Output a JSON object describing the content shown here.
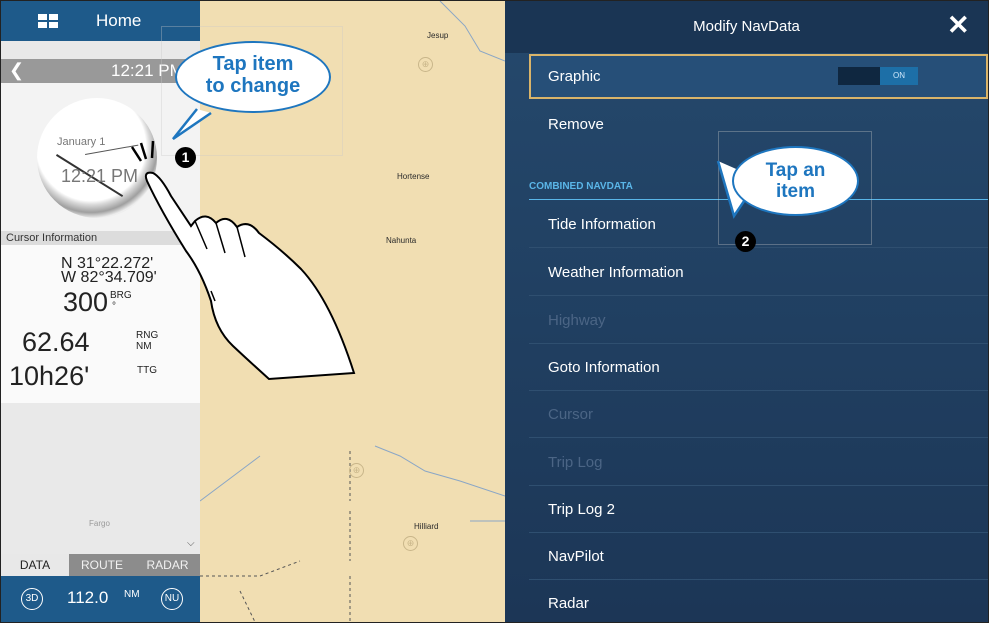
{
  "map": {
    "towns": [
      "Jesup",
      "Hortense",
      "Nahunta",
      "Hilliard",
      "Fargo"
    ]
  },
  "left_panel": {
    "title": "Home",
    "time": "12:21 PM",
    "clock_date": "January 1",
    "clock_time": "12:21 PM",
    "cursor_header": "Cursor Information",
    "lat": "N 31°22.272'",
    "lon": "W 82°34.709'",
    "brg_value": "300",
    "brg_unit": "BRG",
    "brg_deg": "°",
    "rng_value": "62.64",
    "rng_unit": "RNG",
    "rng_nm": "NM",
    "ttg_value": "10h26'",
    "ttg_unit": "TTG",
    "tabs": [
      "DATA",
      "ROUTE",
      "RADAR"
    ],
    "btn_3d": "3D",
    "range_value": "112.0",
    "range_unit": "NM",
    "btn_nu": "NU"
  },
  "panel": {
    "title": "Modify NavData",
    "close_glyph": "✕",
    "graphic_label": "Graphic",
    "toggle_state": "ON",
    "remove_label": "Remove",
    "section_label": "COMBINED NAVDATA",
    "items": [
      {
        "label": "Tide Information",
        "enabled": true
      },
      {
        "label": "Weather Information",
        "enabled": true
      },
      {
        "label": "Highway",
        "enabled": false
      },
      {
        "label": "Goto Information",
        "enabled": true
      },
      {
        "label": "Cursor",
        "enabled": false
      },
      {
        "label": "Trip Log",
        "enabled": false
      },
      {
        "label": "Trip Log 2",
        "enabled": true
      },
      {
        "label": "NavPilot",
        "enabled": true
      },
      {
        "label": "Radar",
        "enabled": true
      }
    ]
  },
  "callouts": {
    "one_text_line1": "Tap item",
    "one_text_line2": "to change",
    "one_number": "1",
    "two_text_line1": "Tap an",
    "two_text_line2": "item",
    "two_number": "2"
  },
  "colors": {
    "header_blue": "#1e5a8a",
    "panel_bg": "#25496d",
    "accent_cyan": "#5ab6e8",
    "highlight_gold": "#d9b46a",
    "callout_blue": "#1e76bf",
    "map_sand": "#f1deb2"
  }
}
